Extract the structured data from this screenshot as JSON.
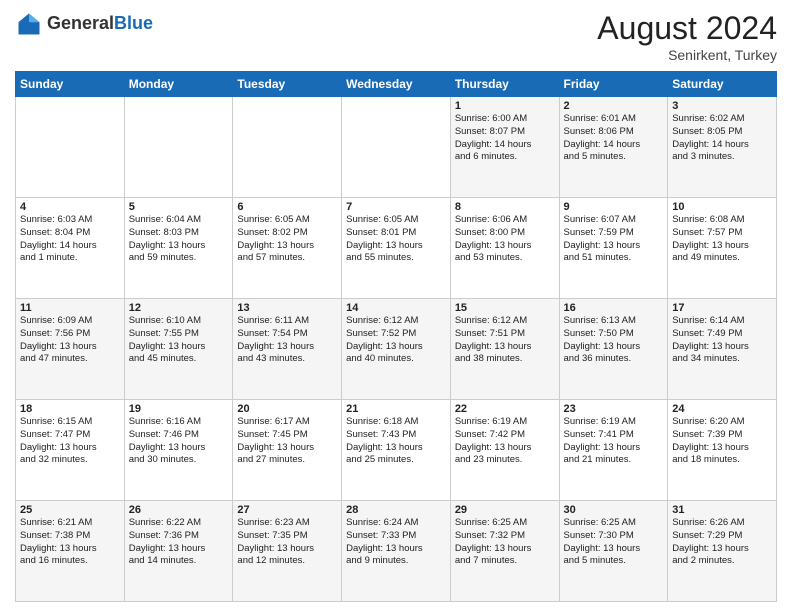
{
  "header": {
    "logo_general": "General",
    "logo_blue": "Blue",
    "month_title": "August 2024",
    "location": "Senirkent, Turkey"
  },
  "weekdays": [
    "Sunday",
    "Monday",
    "Tuesday",
    "Wednesday",
    "Thursday",
    "Friday",
    "Saturday"
  ],
  "weeks": [
    [
      {
        "day": "",
        "info": ""
      },
      {
        "day": "",
        "info": ""
      },
      {
        "day": "",
        "info": ""
      },
      {
        "day": "",
        "info": ""
      },
      {
        "day": "1",
        "info": "Sunrise: 6:00 AM\nSunset: 8:07 PM\nDaylight: 14 hours\nand 6 minutes."
      },
      {
        "day": "2",
        "info": "Sunrise: 6:01 AM\nSunset: 8:06 PM\nDaylight: 14 hours\nand 5 minutes."
      },
      {
        "day": "3",
        "info": "Sunrise: 6:02 AM\nSunset: 8:05 PM\nDaylight: 14 hours\nand 3 minutes."
      }
    ],
    [
      {
        "day": "4",
        "info": "Sunrise: 6:03 AM\nSunset: 8:04 PM\nDaylight: 14 hours\nand 1 minute."
      },
      {
        "day": "5",
        "info": "Sunrise: 6:04 AM\nSunset: 8:03 PM\nDaylight: 13 hours\nand 59 minutes."
      },
      {
        "day": "6",
        "info": "Sunrise: 6:05 AM\nSunset: 8:02 PM\nDaylight: 13 hours\nand 57 minutes."
      },
      {
        "day": "7",
        "info": "Sunrise: 6:05 AM\nSunset: 8:01 PM\nDaylight: 13 hours\nand 55 minutes."
      },
      {
        "day": "8",
        "info": "Sunrise: 6:06 AM\nSunset: 8:00 PM\nDaylight: 13 hours\nand 53 minutes."
      },
      {
        "day": "9",
        "info": "Sunrise: 6:07 AM\nSunset: 7:59 PM\nDaylight: 13 hours\nand 51 minutes."
      },
      {
        "day": "10",
        "info": "Sunrise: 6:08 AM\nSunset: 7:57 PM\nDaylight: 13 hours\nand 49 minutes."
      }
    ],
    [
      {
        "day": "11",
        "info": "Sunrise: 6:09 AM\nSunset: 7:56 PM\nDaylight: 13 hours\nand 47 minutes."
      },
      {
        "day": "12",
        "info": "Sunrise: 6:10 AM\nSunset: 7:55 PM\nDaylight: 13 hours\nand 45 minutes."
      },
      {
        "day": "13",
        "info": "Sunrise: 6:11 AM\nSunset: 7:54 PM\nDaylight: 13 hours\nand 43 minutes."
      },
      {
        "day": "14",
        "info": "Sunrise: 6:12 AM\nSunset: 7:52 PM\nDaylight: 13 hours\nand 40 minutes."
      },
      {
        "day": "15",
        "info": "Sunrise: 6:12 AM\nSunset: 7:51 PM\nDaylight: 13 hours\nand 38 minutes."
      },
      {
        "day": "16",
        "info": "Sunrise: 6:13 AM\nSunset: 7:50 PM\nDaylight: 13 hours\nand 36 minutes."
      },
      {
        "day": "17",
        "info": "Sunrise: 6:14 AM\nSunset: 7:49 PM\nDaylight: 13 hours\nand 34 minutes."
      }
    ],
    [
      {
        "day": "18",
        "info": "Sunrise: 6:15 AM\nSunset: 7:47 PM\nDaylight: 13 hours\nand 32 minutes."
      },
      {
        "day": "19",
        "info": "Sunrise: 6:16 AM\nSunset: 7:46 PM\nDaylight: 13 hours\nand 30 minutes."
      },
      {
        "day": "20",
        "info": "Sunrise: 6:17 AM\nSunset: 7:45 PM\nDaylight: 13 hours\nand 27 minutes."
      },
      {
        "day": "21",
        "info": "Sunrise: 6:18 AM\nSunset: 7:43 PM\nDaylight: 13 hours\nand 25 minutes."
      },
      {
        "day": "22",
        "info": "Sunrise: 6:19 AM\nSunset: 7:42 PM\nDaylight: 13 hours\nand 23 minutes."
      },
      {
        "day": "23",
        "info": "Sunrise: 6:19 AM\nSunset: 7:41 PM\nDaylight: 13 hours\nand 21 minutes."
      },
      {
        "day": "24",
        "info": "Sunrise: 6:20 AM\nSunset: 7:39 PM\nDaylight: 13 hours\nand 18 minutes."
      }
    ],
    [
      {
        "day": "25",
        "info": "Sunrise: 6:21 AM\nSunset: 7:38 PM\nDaylight: 13 hours\nand 16 minutes."
      },
      {
        "day": "26",
        "info": "Sunrise: 6:22 AM\nSunset: 7:36 PM\nDaylight: 13 hours\nand 14 minutes."
      },
      {
        "day": "27",
        "info": "Sunrise: 6:23 AM\nSunset: 7:35 PM\nDaylight: 13 hours\nand 12 minutes."
      },
      {
        "day": "28",
        "info": "Sunrise: 6:24 AM\nSunset: 7:33 PM\nDaylight: 13 hours\nand 9 minutes."
      },
      {
        "day": "29",
        "info": "Sunrise: 6:25 AM\nSunset: 7:32 PM\nDaylight: 13 hours\nand 7 minutes."
      },
      {
        "day": "30",
        "info": "Sunrise: 6:25 AM\nSunset: 7:30 PM\nDaylight: 13 hours\nand 5 minutes."
      },
      {
        "day": "31",
        "info": "Sunrise: 6:26 AM\nSunset: 7:29 PM\nDaylight: 13 hours\nand 2 minutes."
      }
    ]
  ]
}
